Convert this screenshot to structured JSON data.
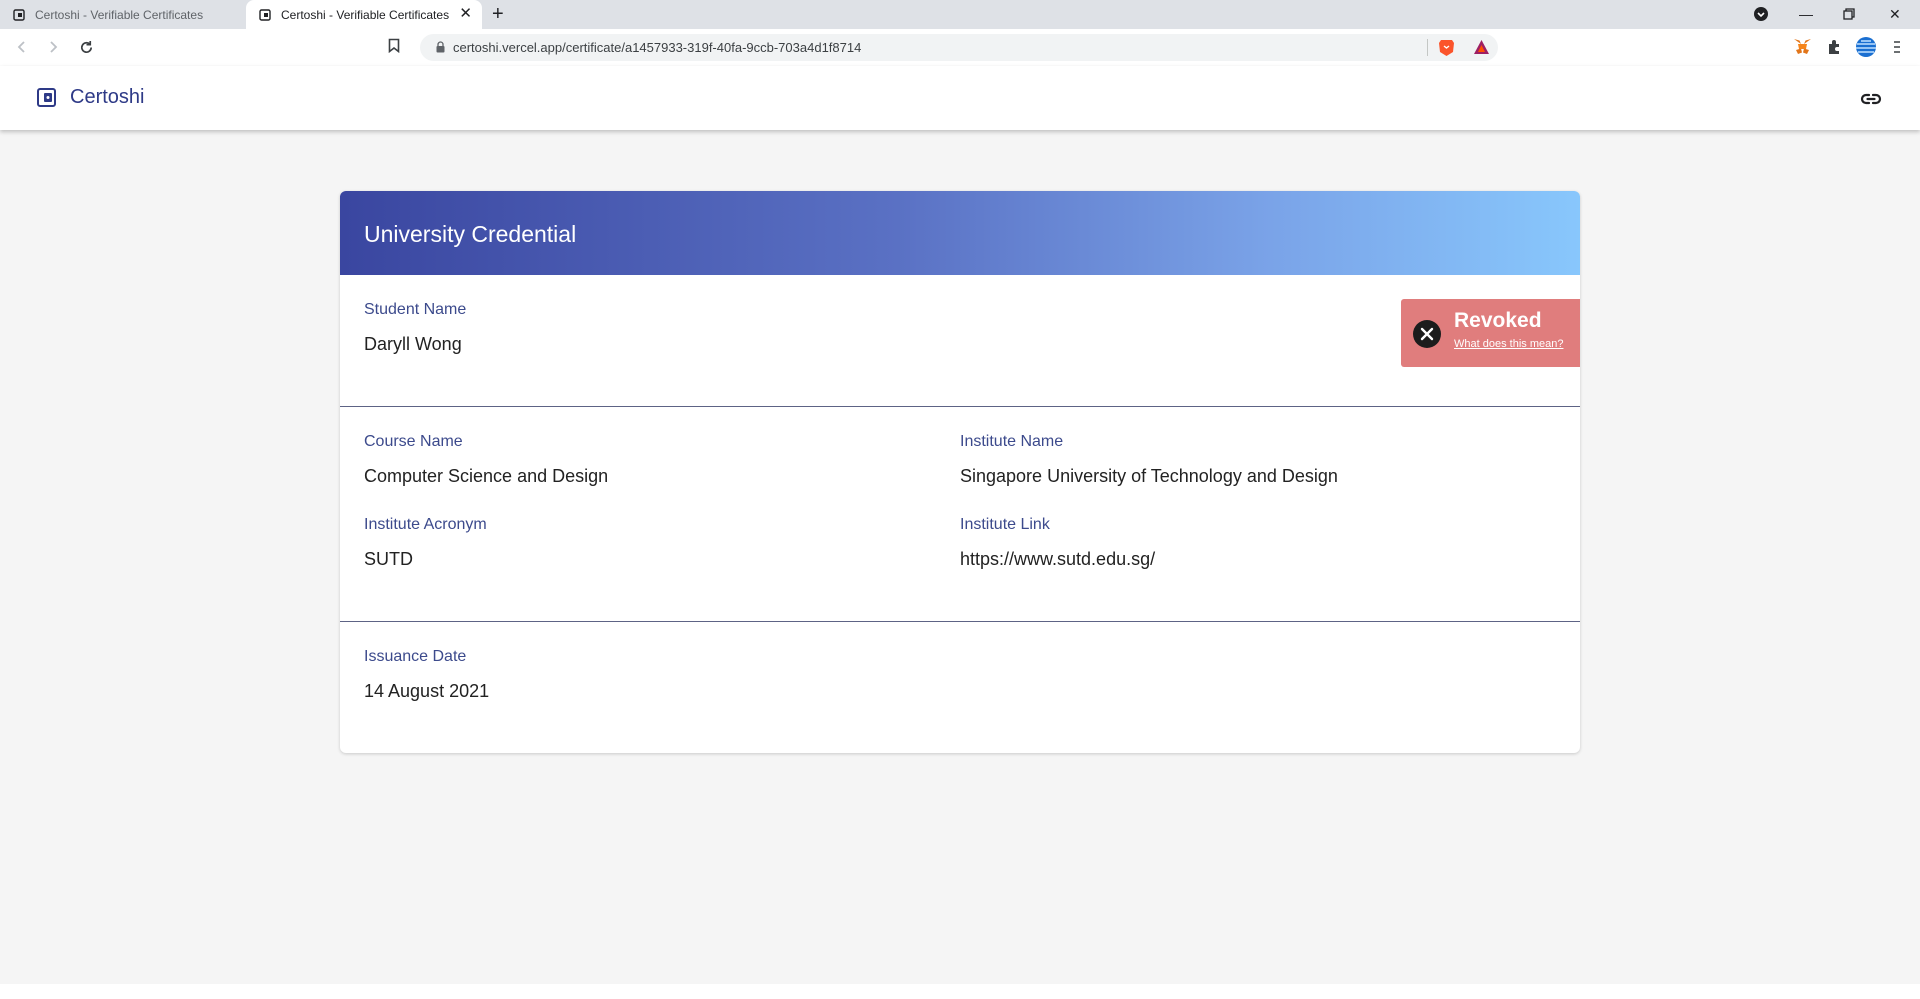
{
  "browser": {
    "tabs": [
      {
        "title": "Certoshi - Verifiable Certificates",
        "active": false
      },
      {
        "title": "Certoshi - Verifiable Certificates",
        "active": true
      }
    ],
    "url": "certoshi.vercel.app/certificate/a1457933-319f-40fa-9ccb-703a4d1f8714"
  },
  "app": {
    "brand": "Certoshi"
  },
  "certificate": {
    "title": "University Credential",
    "status": {
      "label": "Revoked",
      "link_text": "What does this mean?",
      "color": "#e07d7d"
    },
    "student_name_label": "Student Name",
    "student_name": "Daryll Wong",
    "course_name_label": "Course Name",
    "course_name": "Computer Science and Design",
    "institute_name_label": "Institute Name",
    "institute_name": "Singapore University of Technology and Design",
    "institute_acronym_label": "Institute Acronym",
    "institute_acronym": "SUTD",
    "institute_link_label": "Institute Link",
    "institute_link": "https://www.sutd.edu.sg/",
    "issuance_date_label": "Issuance Date",
    "issuance_date": "14 August 2021"
  },
  "colors": {
    "brand": "#2e3a87",
    "header_gradient_start": "#3a46a0",
    "header_gradient_end": "#88c7fc"
  },
  "icons": [
    "certificate-logo-icon",
    "link-icon",
    "close-circle-icon"
  ]
}
